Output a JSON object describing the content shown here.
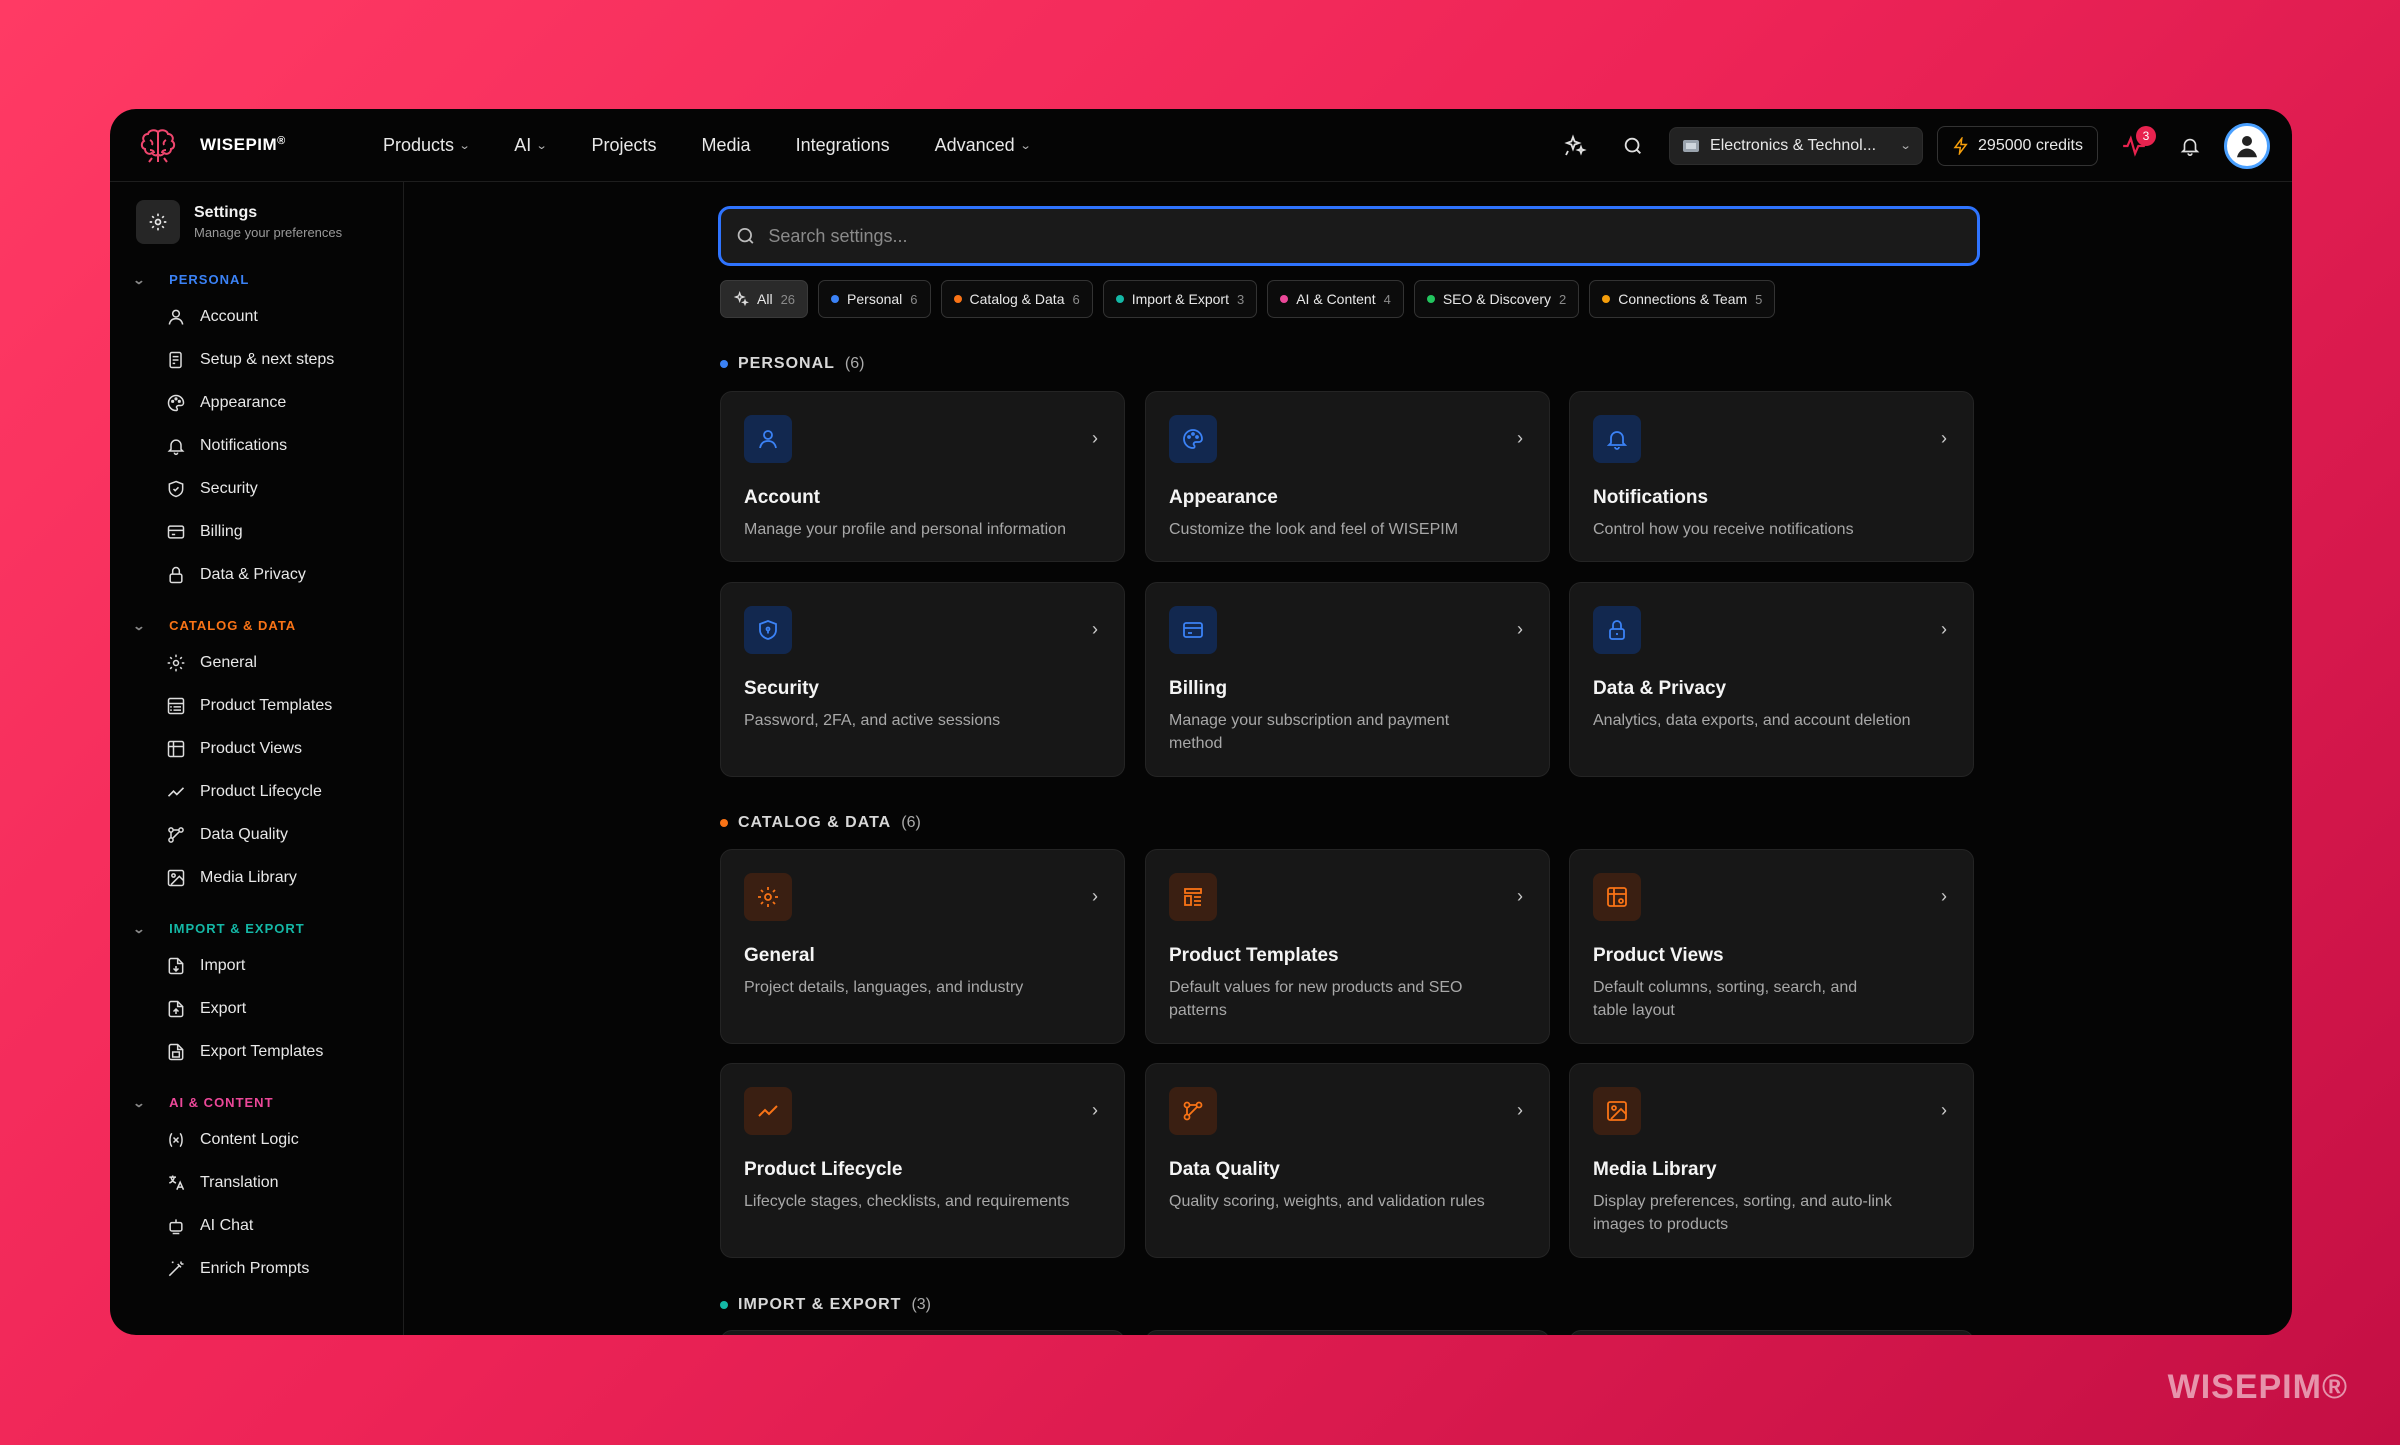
{
  "brand": {
    "name": "WISEPIM",
    "reg": "®",
    "watermark": "WISEPIM®"
  },
  "nav": [
    {
      "label": "Products",
      "dropdown": true
    },
    {
      "label": "AI",
      "dropdown": true
    },
    {
      "label": "Projects",
      "dropdown": false
    },
    {
      "label": "Media",
      "dropdown": false
    },
    {
      "label": "Integrations",
      "dropdown": false
    },
    {
      "label": "Advanced",
      "dropdown": true
    }
  ],
  "topbar": {
    "workspace": "Electronics & Technol...",
    "credits": "295000 credits",
    "notification_badge": "3"
  },
  "sidebar": {
    "title": "Settings",
    "subtitle": "Manage your preferences",
    "sections": [
      {
        "label": "PERSONAL",
        "color": "#3b82f6",
        "items": [
          "Account",
          "Setup & next steps",
          "Appearance",
          "Notifications",
          "Security",
          "Billing",
          "Data & Privacy"
        ]
      },
      {
        "label": "CATALOG & DATA",
        "color": "#f97316",
        "items": [
          "General",
          "Product Templates",
          "Product Views",
          "Product Lifecycle",
          "Data Quality",
          "Media Library"
        ]
      },
      {
        "label": "IMPORT & EXPORT",
        "color": "#14b8a6",
        "items": [
          "Import",
          "Export",
          "Export Templates"
        ]
      },
      {
        "label": "AI & CONTENT",
        "color": "#ec4899",
        "items": [
          "Content Logic",
          "Translation",
          "AI Chat",
          "Enrich Prompts"
        ]
      }
    ]
  },
  "search": {
    "placeholder": "Search settings..."
  },
  "chips": [
    {
      "label": "All",
      "count": "26",
      "color": "",
      "icon": "sparkles-icon"
    },
    {
      "label": "Personal",
      "count": "6",
      "color": "#3b82f6"
    },
    {
      "label": "Catalog & Data",
      "count": "6",
      "color": "#f97316"
    },
    {
      "label": "Import & Export",
      "count": "3",
      "color": "#14b8a6"
    },
    {
      "label": "AI & Content",
      "count": "4",
      "color": "#ec4899"
    },
    {
      "label": "SEO & Discovery",
      "count": "2",
      "color": "#22c55e"
    },
    {
      "label": "Connections & Team",
      "count": "5",
      "color": "#f59e0b"
    }
  ],
  "groups": [
    {
      "label": "PERSONAL",
      "count": "(6)",
      "color": "#3b82f6",
      "cards": [
        {
          "title": "Account",
          "desc": "Manage your profile and personal information",
          "icon": "user-icon"
        },
        {
          "title": "Appearance",
          "desc": "Customize the look and feel of WISEPIM",
          "icon": "palette-icon"
        },
        {
          "title": "Notifications",
          "desc": "Control how you receive notifications",
          "icon": "bell-icon"
        },
        {
          "title": "Security",
          "desc": "Password, 2FA, and active sessions",
          "icon": "shield-icon"
        },
        {
          "title": "Billing",
          "desc": "Manage your subscription and payment method",
          "icon": "credit-card-icon"
        },
        {
          "title": "Data & Privacy",
          "desc": "Analytics, data exports, and account deletion",
          "icon": "lock-icon"
        }
      ]
    },
    {
      "label": "CATALOG & DATA",
      "count": "(6)",
      "color": "#f97316",
      "cards": [
        {
          "title": "General",
          "desc": "Project details, languages, and industry",
          "icon": "gear-icon"
        },
        {
          "title": "Product Templates",
          "desc": "Default values for new products and SEO patterns",
          "icon": "template-icon"
        },
        {
          "title": "Product Views",
          "desc": "Default columns, sorting, search, and table layout",
          "icon": "table-icon"
        },
        {
          "title": "Product Lifecycle",
          "desc": "Lifecycle stages, checklists, and requirements",
          "icon": "trend-icon"
        },
        {
          "title": "Data Quality",
          "desc": "Quality scoring, weights, and validation rules",
          "icon": "workflow-icon"
        },
        {
          "title": "Media Library",
          "desc": "Display preferences, sorting, and auto-link images to products",
          "icon": "image-icon"
        }
      ]
    },
    {
      "label": "IMPORT & EXPORT",
      "count": "(3)",
      "color": "#14b8a6",
      "cards": []
    }
  ]
}
